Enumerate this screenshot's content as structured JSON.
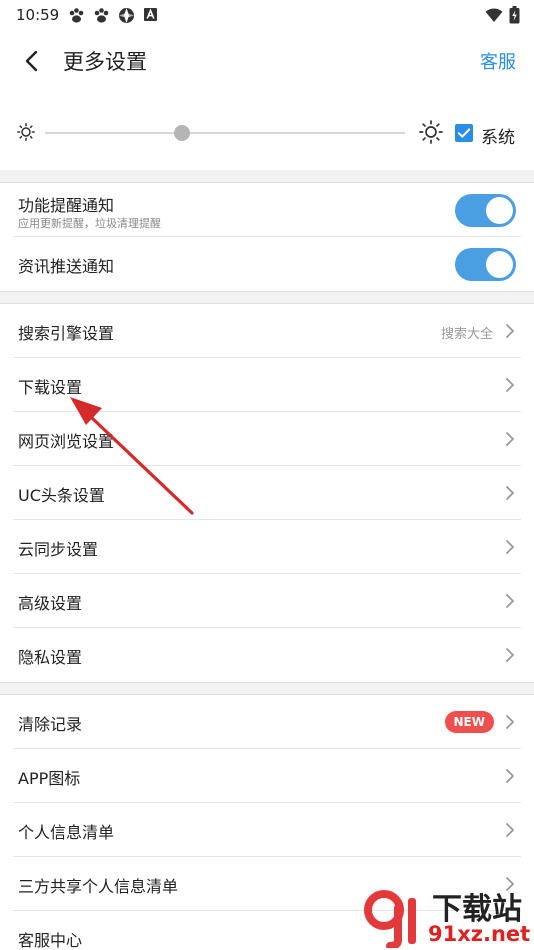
{
  "status_bar": {
    "time": "10:59",
    "app_icons": [
      "paw-icon",
      "paw-icon",
      "browser-icon",
      "a-icon"
    ],
    "system_icons": [
      "wifi-icon",
      "battery-icon"
    ]
  },
  "header": {
    "title": "更多设置",
    "back_icon": "chevron-left-icon",
    "service_label": "客服"
  },
  "brightness": {
    "partial_label": "亮度",
    "level": 0.38,
    "system_label": "系统",
    "system_checked": true
  },
  "notifications": [
    {
      "label": "功能提醒通知",
      "sublabel": "应用更新提醒，垃圾清理提醒",
      "enabled": true
    },
    {
      "label": "资讯推送通知",
      "sublabel": "",
      "enabled": true
    }
  ],
  "settings": [
    {
      "label": "搜索引擎设置",
      "value": "搜索大全"
    },
    {
      "label": "下载设置",
      "value": ""
    },
    {
      "label": "网页浏览设置",
      "value": ""
    },
    {
      "label": "UC头条设置",
      "value": ""
    },
    {
      "label": "云同步设置",
      "value": ""
    },
    {
      "label": "高级设置",
      "value": ""
    },
    {
      "label": "隐私设置",
      "value": ""
    }
  ],
  "misc": [
    {
      "label": "清除记录",
      "badge": "NEW"
    },
    {
      "label": "APP图标",
      "badge": ""
    },
    {
      "label": "个人信息清单",
      "badge": ""
    },
    {
      "label": "三方共享个人信息清单",
      "badge": ""
    },
    {
      "label": "客服中心",
      "badge": ""
    }
  ],
  "watermark": {
    "text": "下载站",
    "url": "91xz.net"
  },
  "colors": {
    "accent": "#2a8ee6",
    "toggle": "#4a9fe2",
    "badge": "#f0504d",
    "annotation_arrow": "#d42a2a"
  }
}
